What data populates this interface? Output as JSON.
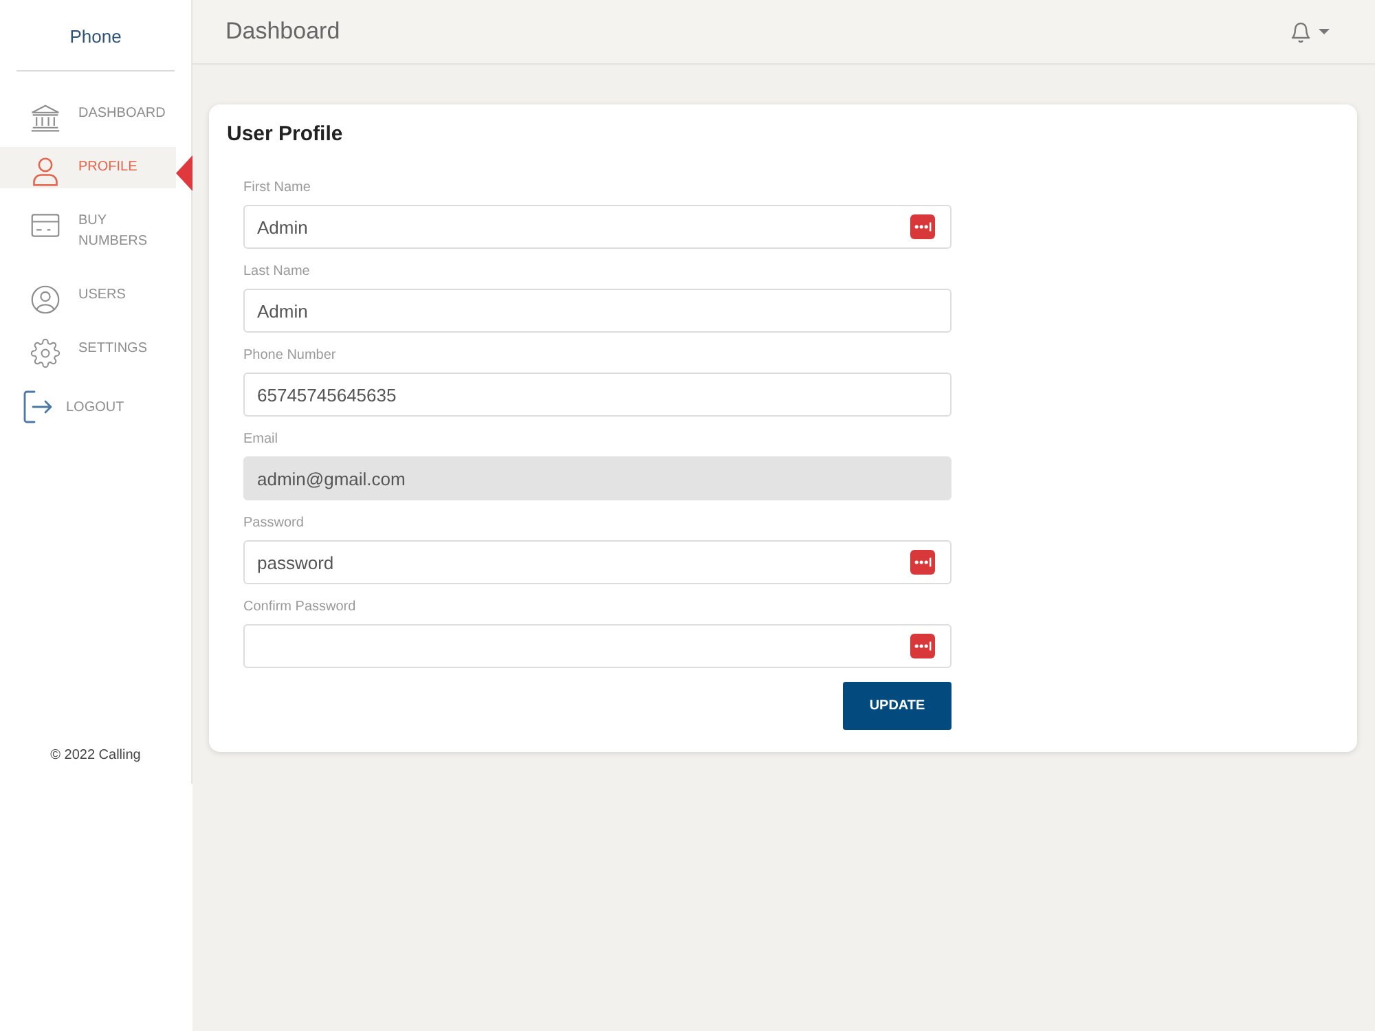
{
  "sidebar": {
    "brand": "Phone",
    "items": [
      {
        "label": "DASHBOARD",
        "selected": false
      },
      {
        "label": "PROFILE",
        "selected": true
      },
      {
        "label": "BUY NUMBERS",
        "selected": false
      },
      {
        "label": "USERS",
        "selected": false
      },
      {
        "label": "SETTINGS",
        "selected": false
      }
    ],
    "logout": {
      "label": "LOGOUT"
    },
    "footer": "© 2022 Calling"
  },
  "header": {
    "title": "Dashboard"
  },
  "profile_card": {
    "title": "User Profile",
    "fields": [
      {
        "label": "First Name",
        "value": "Admin",
        "disabled": false,
        "password_manager": true
      },
      {
        "label": "Last Name",
        "value": "Admin",
        "disabled": false,
        "password_manager": false
      },
      {
        "label": "Phone Number",
        "value": "65745745645635",
        "disabled": false,
        "password_manager": false
      },
      {
        "label": "Email",
        "value": "admin@gmail.com",
        "disabled": true,
        "password_manager": false
      },
      {
        "label": "Password",
        "value": "password",
        "disabled": false,
        "password_manager": true
      },
      {
        "label": "Confirm Password",
        "disabled": false,
        "password_manager": true
      }
    ],
    "submit_button": "UPDATE"
  }
}
